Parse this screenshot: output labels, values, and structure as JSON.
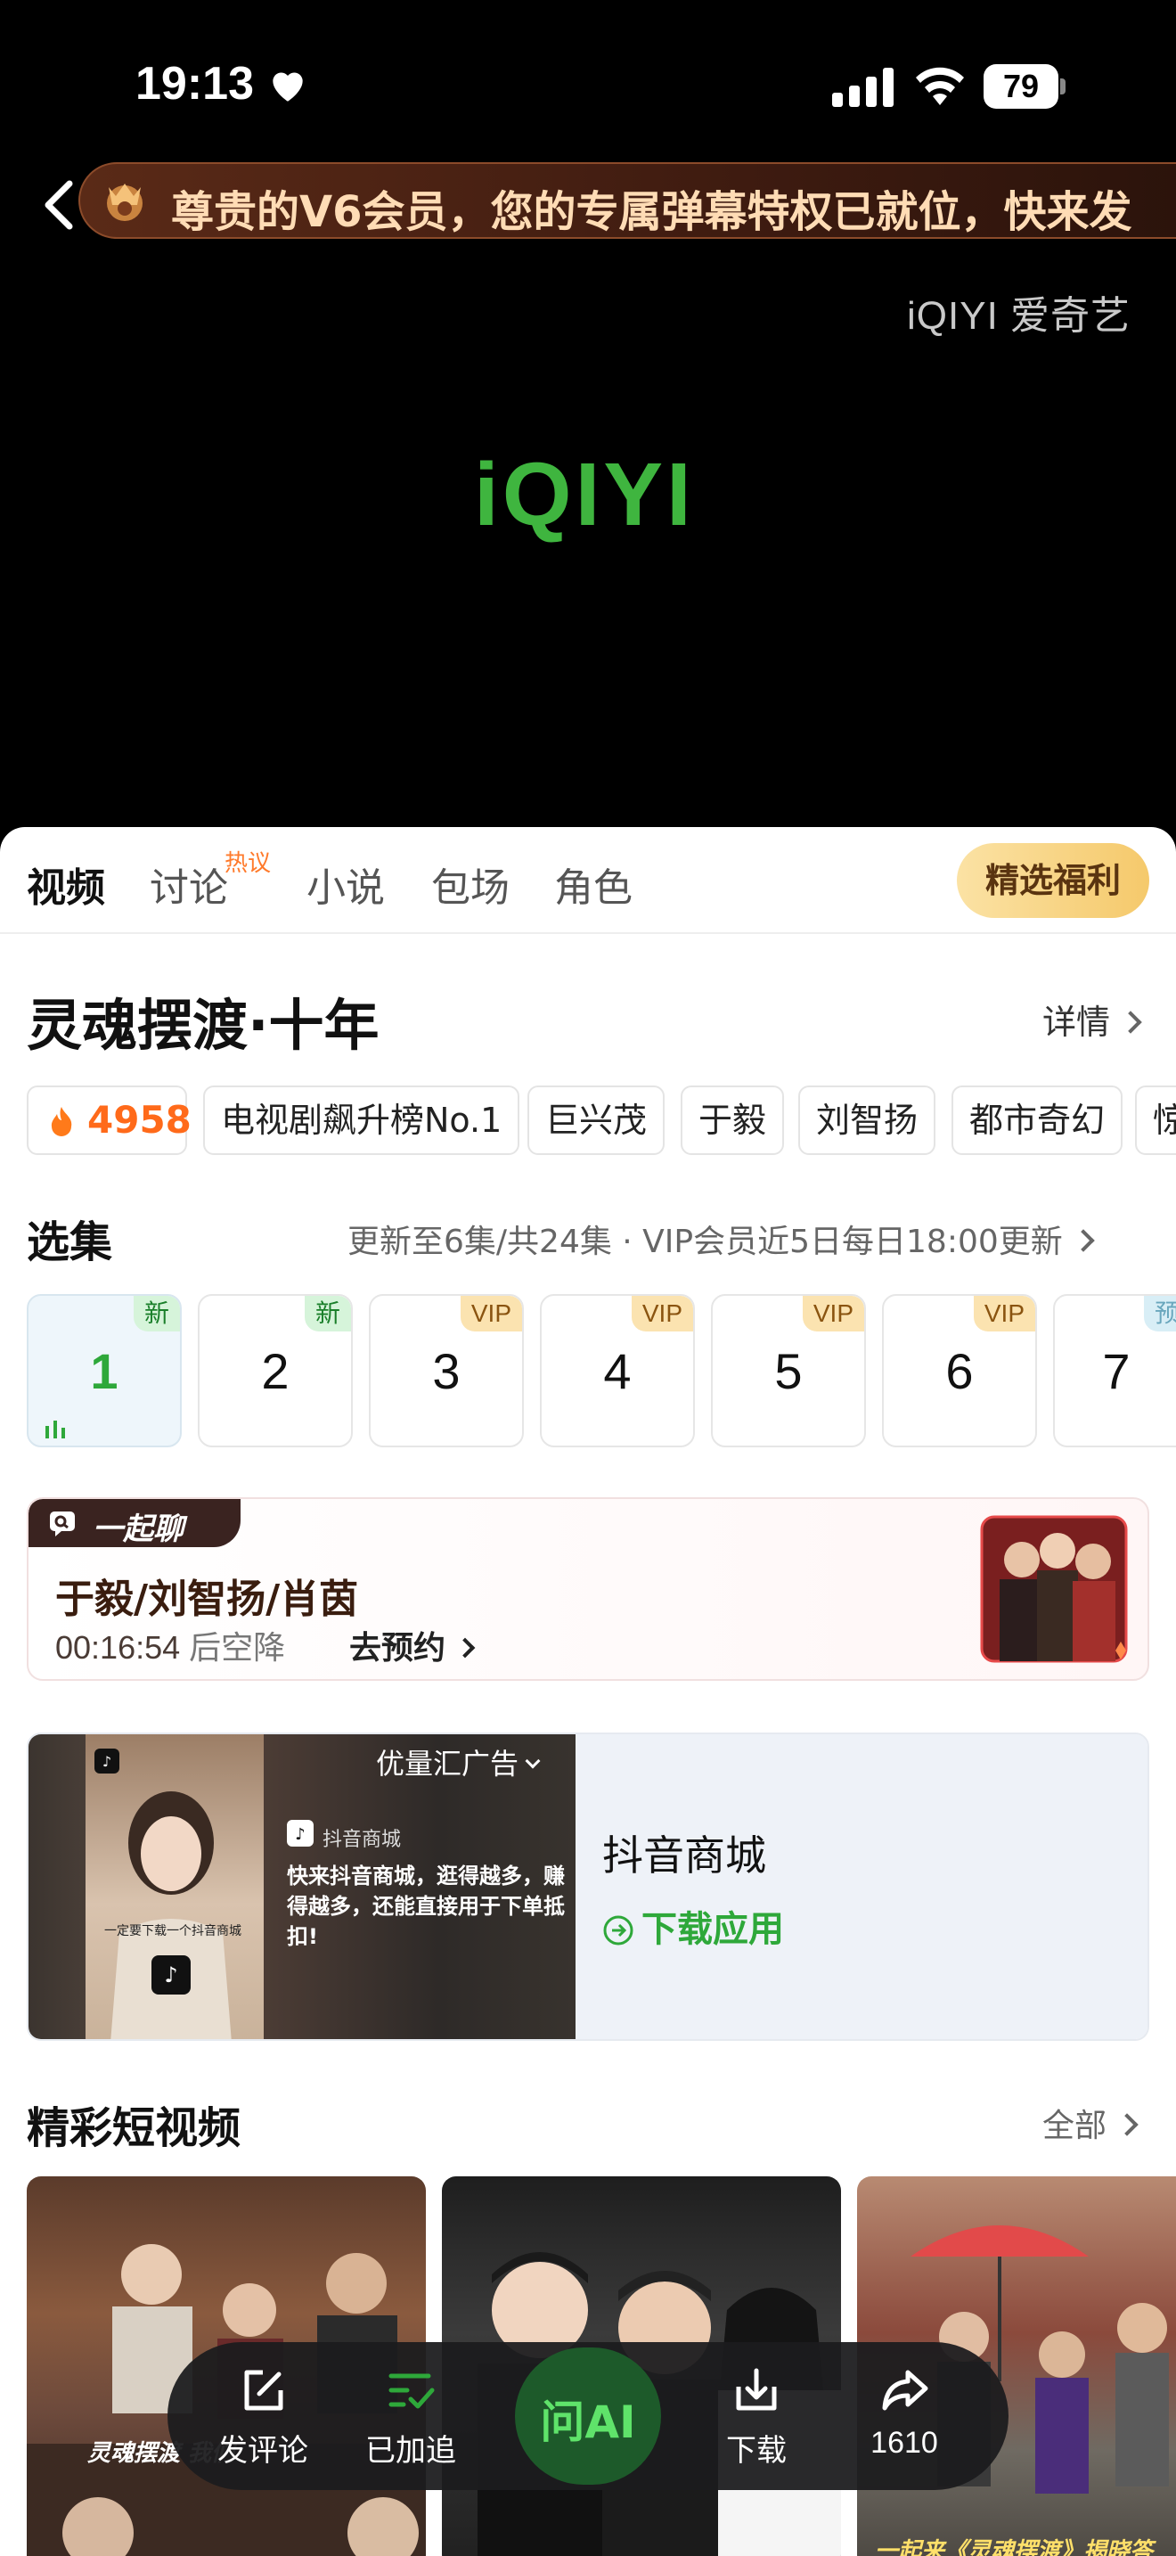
{
  "status_bar": {
    "time": "19:13",
    "battery": "79"
  },
  "player": {
    "banner_text": "尊贵的V6会员，您的专属弹幕特权已就位，快来发",
    "watermark": "iQIYI 爱奇艺",
    "logo": "iQIYI"
  },
  "tabs": [
    {
      "label": "视频"
    },
    {
      "label": "讨论",
      "badge": "热议"
    },
    {
      "label": "小说"
    },
    {
      "label": "包场"
    },
    {
      "label": "角色"
    }
  ],
  "welfare_button": "精选福利",
  "show": {
    "title": "灵魂摆渡·十年",
    "detail_link": "详情",
    "heat": "4958",
    "tags": [
      "电视剧飙升榜No.1",
      "巨兴茂",
      "于毅",
      "刘智扬",
      "都市奇幻",
      "惊"
    ]
  },
  "episodes": {
    "title": "选集",
    "update_info": "更新至6集/共24集 · VIP会员近5日每日18:00更新",
    "items": [
      {
        "num": "1",
        "badge": "新",
        "badge_type": "new"
      },
      {
        "num": "2",
        "badge": "新",
        "badge_type": "new"
      },
      {
        "num": "3",
        "badge": "VIP",
        "badge_type": "vip"
      },
      {
        "num": "4",
        "badge": "VIP",
        "badge_type": "vip"
      },
      {
        "num": "5",
        "badge": "VIP",
        "badge_type": "vip"
      },
      {
        "num": "6",
        "badge": "VIP",
        "badge_type": "vip"
      },
      {
        "num": "7",
        "badge": "预",
        "badge_type": "pre"
      }
    ]
  },
  "chat_room": {
    "tag": "一起聊",
    "cast": "于毅/刘智扬/肖茵",
    "countdown": "00:16:54",
    "countdown_suffix": "后空降",
    "reserve": "去预约"
  },
  "ad": {
    "sponsor_label": "优量汇广告",
    "store_label": "抖音商城",
    "copy": "快来抖音商城，逛得越多，赚得越多，还能直接用于下单抵扣!",
    "video_caption": "一定要下载一个抖音商城",
    "name": "抖音商城",
    "download": "下载应用"
  },
  "shorts": {
    "title": "精彩短视频",
    "all_link": "全部",
    "captions": [
      "灵魂摆渡 我们",
      "",
      "一起来《灵魂摆渡》揭晓答"
    ]
  },
  "dock": {
    "comment": "发评论",
    "followed": "已加追",
    "ai": "问AI",
    "download": "下载",
    "share_count": "1610"
  },
  "colors": {
    "accent_green": "#2ea83a",
    "heat_orange": "#ff6a1a",
    "banner_text": "#ffdcb5"
  }
}
